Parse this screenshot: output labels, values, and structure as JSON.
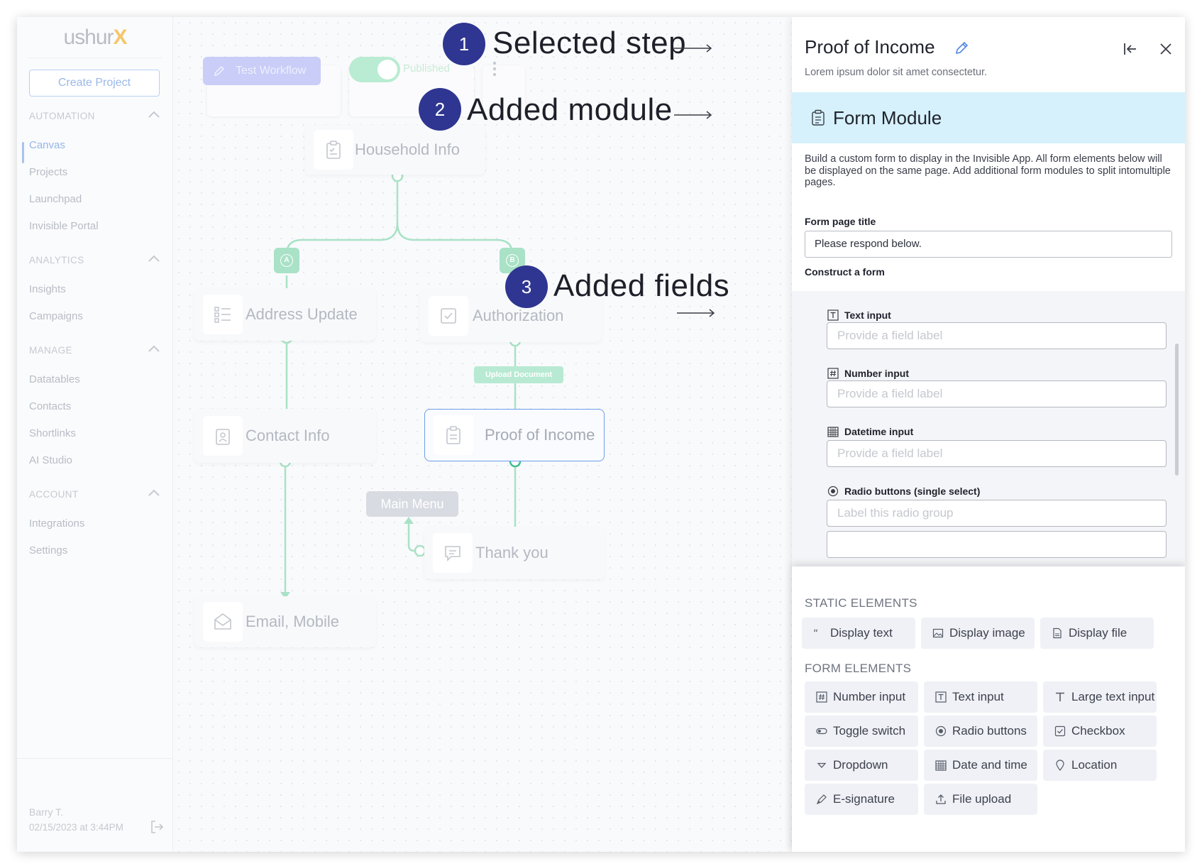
{
  "brand": {
    "logo_text": "ushur",
    "logo_mark": "X"
  },
  "sidebar": {
    "create_button": "Create Project",
    "sections": [
      {
        "title": "AUTOMATION",
        "items": [
          "Canvas",
          "Projects",
          "Launchpad",
          "Invisible Portal"
        ]
      },
      {
        "title": "ANALYTICS",
        "items": [
          "Insights",
          "Campaigns"
        ]
      },
      {
        "title": "MANAGE",
        "items": [
          "Datatables",
          "Contacts",
          "Shortlinks",
          "AI Studio"
        ]
      },
      {
        "title": "ACCOUNT",
        "items": [
          "Integrations",
          "Settings"
        ]
      }
    ],
    "active_item": "Canvas",
    "user": {
      "name": "Barry T.",
      "date": "02/15/2023 at 3:44PM"
    }
  },
  "toolbar": {
    "test_button": "Test Workflow",
    "published_label": "Published",
    "published_on": true
  },
  "canvas": {
    "nodes": {
      "household": "Household Info",
      "address": "Address Update",
      "authorization": "Authorization",
      "contact": "Contact Info",
      "proof": "Proof of Income",
      "thankyou": "Thank you",
      "email": "Email, Mobile"
    },
    "branch_a": "A",
    "branch_b": "B",
    "upload_tag": "Upload Document",
    "main_menu_tag": "Main Menu"
  },
  "callouts": [
    {
      "number": "1",
      "text": "Selected step"
    },
    {
      "number": "2",
      "text": "Added module"
    },
    {
      "number": "3",
      "text": "Added fields"
    }
  ],
  "panel": {
    "title": "Proof of Income",
    "subtitle": "Lorem ipsum dolor sit amet consectetur.",
    "module_title": "Form Module",
    "description": "Build a custom form to display in the Invisible App. All form elements below will be displayed on the same page. Add additional form modules to split intomultiple pages.",
    "form_page_title_label": "Form page title",
    "form_page_title_value": "Please respond below.",
    "construct_label": "Construct a form",
    "fields": [
      {
        "type": "Text input",
        "placeholder": "Provide a field label"
      },
      {
        "type": "Number input",
        "placeholder": "Provide a field label"
      },
      {
        "type": "Datetime input",
        "placeholder": "Provide a field label"
      },
      {
        "type": "Radio buttons (single select)",
        "placeholder": "Label this radio group"
      }
    ],
    "static_heading": "STATIC ELEMENTS",
    "static_elements": [
      "Display text",
      "Display image",
      "Display file"
    ],
    "form_heading": "FORM ELEMENTS",
    "form_elements": [
      "Number input",
      "Text input",
      "Large text input",
      "Toggle switch",
      "Radio buttons",
      "Checkbox",
      "Dropdown",
      "Date and time",
      "Location",
      "E-signature",
      "File upload"
    ]
  },
  "colors": {
    "accent": "#2e3691",
    "module_bar": "#d6f1fb",
    "connector": "#a9e2c6",
    "selected_border": "#6d9ee8"
  }
}
